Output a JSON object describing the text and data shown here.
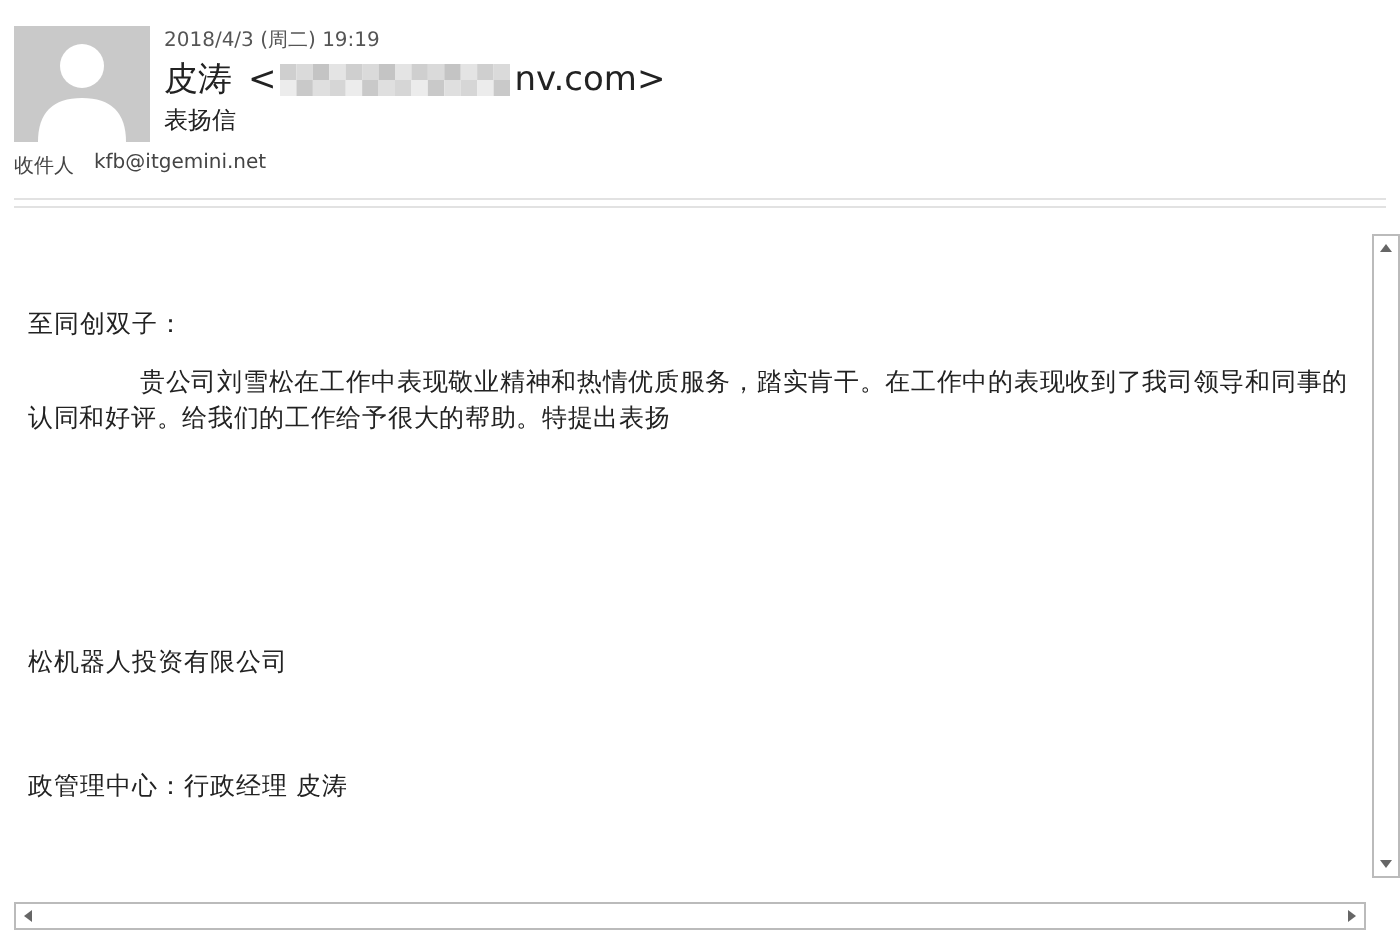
{
  "header": {
    "date": "2018/4/3 (周二) 19:19",
    "sender_name": "皮涛",
    "address_prefix": "<",
    "address_redacted": true,
    "address_suffix": "nv.com>",
    "subject": "表扬信",
    "recipient_label": "收件人",
    "recipient": "kfb@itgemini.net"
  },
  "body": {
    "greeting": "至同创双子：",
    "paragraph": "贵公司刘雪松在工作中表现敬业精神和热情优质服务，踏实肯干。在工作中的表现收到了我司领导和同事的认同和好评。给我们的工作给予很大的帮助。特提出表扬",
    "company": "松机器人投资有限公司",
    "signature": "政管理中心：行政经理  皮涛"
  }
}
